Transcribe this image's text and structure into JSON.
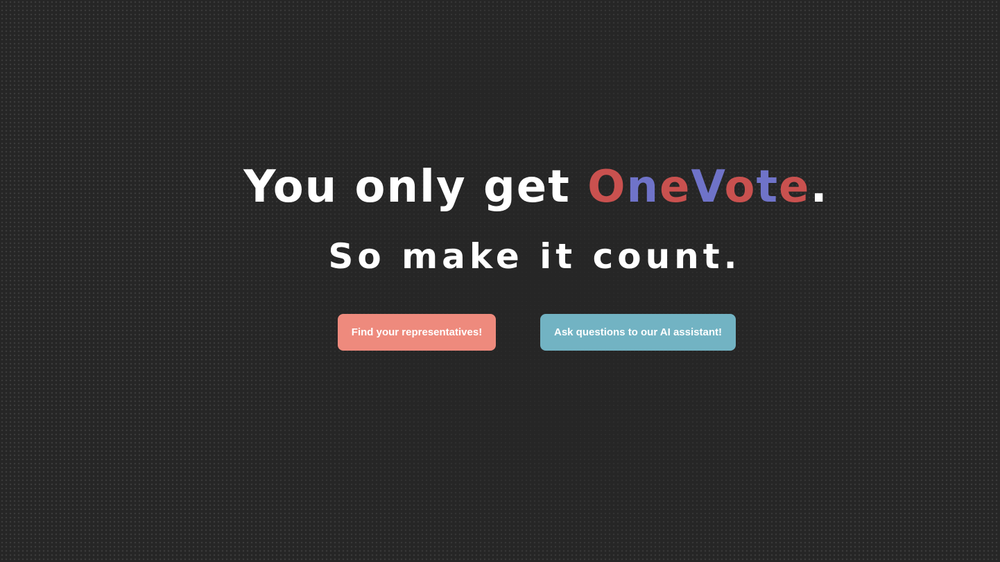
{
  "hero": {
    "headline_prefix": "You only get ",
    "brand_letters": [
      {
        "text": "O",
        "color": "red"
      },
      {
        "text": "n",
        "color": "blue"
      },
      {
        "text": "e",
        "color": "red"
      },
      {
        "text": "V",
        "color": "blue"
      },
      {
        "text": "o",
        "color": "red"
      },
      {
        "text": "t",
        "color": "blue"
      },
      {
        "text": "e",
        "color": "red"
      }
    ],
    "headline_suffix": ".",
    "subheadline": "So make it count."
  },
  "actions": {
    "find_representatives": "Find your representatives!",
    "ask_assistant": "Ask questions to our AI assistant!"
  },
  "colors": {
    "background": "#262626",
    "brand_red": "#c9514f",
    "brand_blue": "#6f73c9",
    "button_red": "#ee8a7d",
    "button_blue": "#72b3c3"
  }
}
